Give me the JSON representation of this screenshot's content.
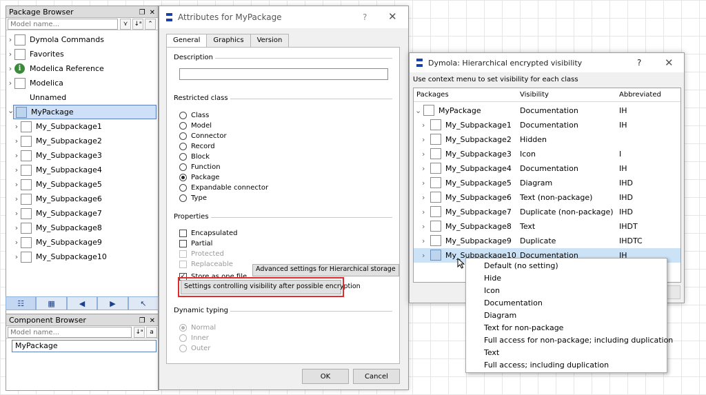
{
  "package_browser": {
    "title": "Package Browser",
    "search_placeholder": "Model name...",
    "items": [
      {
        "label": "Dymola Commands",
        "icon": "box"
      },
      {
        "label": "Favorites",
        "icon": "box"
      },
      {
        "label": "Modelica Reference",
        "icon": "info"
      },
      {
        "label": "Modelica",
        "icon": "box"
      },
      {
        "label": "Unnamed",
        "icon": "none"
      },
      {
        "label": "MyPackage",
        "icon": "box-blue"
      }
    ],
    "subpackages": [
      "My_Subpackage1",
      "My_Subpackage2",
      "My_Subpackage3",
      "My_Subpackage4",
      "My_Subpackage5",
      "My_Subpackage6",
      "My_Subpackage7",
      "My_Subpackage8",
      "My_Subpackage9",
      "My_Subpackage10"
    ]
  },
  "component_browser": {
    "title": "Component Browser",
    "search_placeholder": "Model name...",
    "item": "MyPackage"
  },
  "attributes_dialog": {
    "title": "Attributes for MyPackage",
    "help": "?",
    "close": "✕",
    "tabs": [
      "General",
      "Graphics",
      "Version"
    ],
    "description_label": "Description",
    "description_value": "",
    "restricted_class_label": "Restricted class",
    "restricted_options": [
      "Class",
      "Model",
      "Connector",
      "Record",
      "Block",
      "Function",
      "Package",
      "Expandable connector",
      "Type"
    ],
    "selected_restricted": "Package",
    "properties_label": "Properties",
    "properties": [
      {
        "label": "Encapsulated",
        "checked": false,
        "disabled": false
      },
      {
        "label": "Partial",
        "checked": false,
        "disabled": false
      },
      {
        "label": "Protected",
        "checked": false,
        "disabled": true
      },
      {
        "label": "Replaceable",
        "checked": false,
        "disabled": true
      },
      {
        "label": "Store as one file",
        "checked": true,
        "disabled": false
      }
    ],
    "advanced_button": "Advanced settings for Hierarchical storage",
    "visibility_button": "Settings controlling visibility after possible encryption",
    "dynamic_typing_label": "Dynamic typing",
    "dynamic_options": [
      "Normal",
      "Inner",
      "Outer"
    ],
    "ok_label": "OK",
    "cancel_label": "Cancel"
  },
  "hier_dialog": {
    "title": "Dymola: Hierarchical encrypted visibility",
    "help": "?",
    "close": "✕",
    "hint": "Use context menu to set visibility for each class",
    "columns": [
      "Packages",
      "Visibility",
      "Abbreviated"
    ],
    "rows": [
      {
        "name": "MyPackage",
        "visibility": "Documentation",
        "abbr": "IH"
      },
      {
        "name": "My_Subpackage1",
        "visibility": "Documentation",
        "abbr": "IH"
      },
      {
        "name": "My_Subpackage2",
        "visibility": "Hidden",
        "abbr": ""
      },
      {
        "name": "My_Subpackage3",
        "visibility": "Icon",
        "abbr": "I"
      },
      {
        "name": "My_Subpackage4",
        "visibility": "Documentation",
        "abbr": "IH"
      },
      {
        "name": "My_Subpackage5",
        "visibility": "Diagram",
        "abbr": "IHD"
      },
      {
        "name": "My_Subpackage6",
        "visibility": "Text (non-package)",
        "abbr": "IHD"
      },
      {
        "name": "My_Subpackage7",
        "visibility": "Duplicate (non-package)",
        "abbr": "IHD"
      },
      {
        "name": "My_Subpackage8",
        "visibility": "Text",
        "abbr": "IHDT"
      },
      {
        "name": "My_Subpackage9",
        "visibility": "Duplicate",
        "abbr": "IHDTC"
      },
      {
        "name": "My_Subpackage10",
        "visibility": "Documentation",
        "abbr": "IH"
      }
    ]
  },
  "context_menu": {
    "items": [
      "Default (no setting)",
      "Hide",
      "Icon",
      "Documentation",
      "Diagram",
      "Text for non-package",
      "Full access for non-package; including duplication",
      "Text",
      "Full access; including duplication"
    ]
  },
  "colors": {
    "accent_blue": "#1a3faa",
    "selection": "#cde0f7",
    "highlight_red": "#e12a2a"
  }
}
